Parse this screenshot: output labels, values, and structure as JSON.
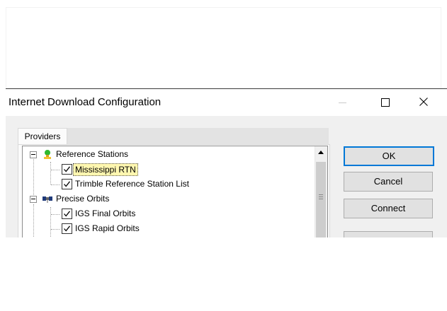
{
  "window": {
    "title": "Internet Download Configuration",
    "controls": {
      "minimize": "minimize-icon",
      "maximize": "maximize-icon",
      "close": "close-icon"
    }
  },
  "tabs": [
    {
      "label": "Providers",
      "selected": true
    }
  ],
  "tree": {
    "nodes": [
      {
        "label": "Reference Stations",
        "icon": "reference-station-icon",
        "expanded": true,
        "children": [
          {
            "label": "Mississippi RTN",
            "checked": true,
            "selected": true
          },
          {
            "label": "Trimble Reference Station List",
            "checked": true
          }
        ]
      },
      {
        "label": "Precise Orbits",
        "icon": "satellite-icon",
        "expanded": true,
        "children": [
          {
            "label": "IGS Final Orbits",
            "checked": true
          },
          {
            "label": "IGS Rapid Orbits",
            "checked": true
          }
        ]
      }
    ]
  },
  "buttons": {
    "ok": "OK",
    "cancel": "Cancel",
    "connect": "Connect"
  },
  "colors": {
    "accent": "#0078d7",
    "selection_highlight": "#fff7b0"
  }
}
